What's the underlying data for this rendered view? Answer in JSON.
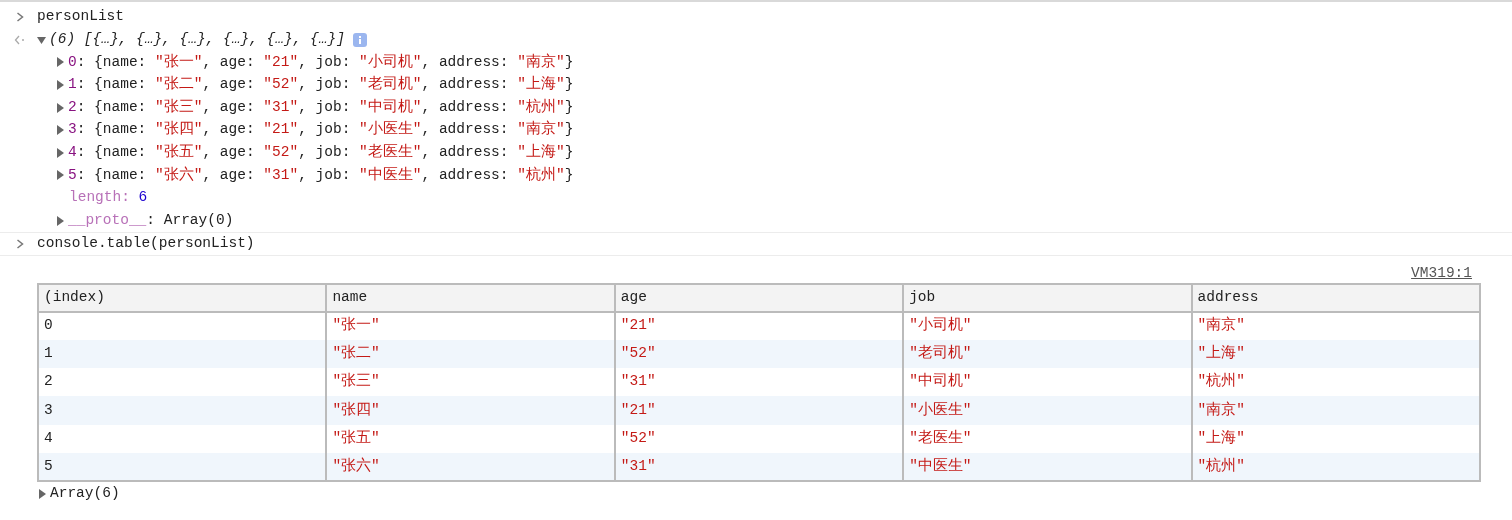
{
  "entries": [
    {
      "kind": "input",
      "text": "personList"
    },
    {
      "kind": "result",
      "summary": "(6) [{…}, {…}, {…}, {…}, {…}, {…}]",
      "expanded": true,
      "children": [
        {
          "kind": "entry",
          "text": "0: {name: \"张一\", age: \"21\", job: \"小司机\", address: \"南京\"}",
          "expanded": false
        },
        {
          "kind": "entry",
          "text": "1: {name: \"张二\", age: \"52\", job: \"老司机\", address: \"上海\"}",
          "expanded": false
        },
        {
          "kind": "entry",
          "text": "2: {name: \"张三\", age: \"31\", job: \"中司机\", address: \"杭州\"}",
          "expanded": false
        },
        {
          "kind": "entry",
          "text": "3: {name: \"张四\", age: \"21\", job: \"小医生\", address: \"南京\"}",
          "expanded": false
        },
        {
          "kind": "entry",
          "text": "4: {name: \"张五\", age: \"52\", job: \"老医生\", address: \"上海\"}",
          "expanded": false
        },
        {
          "kind": "entry",
          "text": "5: {name: \"张六\", age: \"31\", job: \"中医生\", address: \"杭州\"}",
          "expanded": false
        },
        {
          "kind": "length",
          "text": "length: 6"
        },
        {
          "kind": "proto",
          "text": "__proto__: Array(0)",
          "expanded": false
        }
      ]
    },
    {
      "kind": "input",
      "text": "console.table(personList)"
    },
    {
      "kind": "table",
      "source": "VM319:1",
      "columns": [
        "(index)",
        "name",
        "age",
        "job",
        "address"
      ],
      "rows": [
        [
          "0",
          "\"张一\"",
          "\"21\"",
          "\"小司机\"",
          "\"南京\""
        ],
        [
          "1",
          "\"张二\"",
          "\"52\"",
          "\"老司机\"",
          "\"上海\""
        ],
        [
          "2",
          "\"张三\"",
          "\"31\"",
          "\"中司机\"",
          "\"杭州\""
        ],
        [
          "3",
          "\"张四\"",
          "\"21\"",
          "\"小医生\"",
          "\"南京\""
        ],
        [
          "4",
          "\"张五\"",
          "\"52\"",
          "\"老医生\"",
          "\"上海\""
        ],
        [
          "5",
          "\"张六\"",
          "\"31\"",
          "\"中医生\"",
          "\"杭州\""
        ]
      ],
      "footer": {
        "text": "Array(6)",
        "expanded": false
      }
    }
  ]
}
